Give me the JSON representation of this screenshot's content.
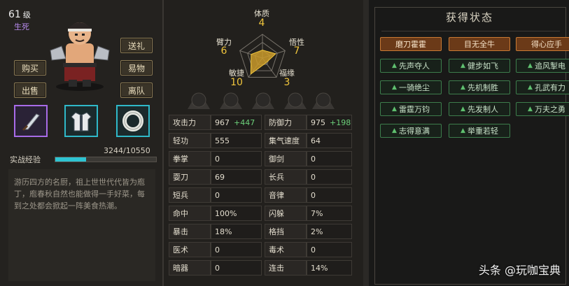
{
  "character": {
    "level": "61",
    "level_unit": "级",
    "title": "生死"
  },
  "buttons": {
    "gift": "送礼",
    "buy": "购买",
    "trade": "易物",
    "sell": "出售",
    "leave": "离队"
  },
  "equipment": [
    {
      "name": "knife-icon"
    },
    {
      "name": "robe-icon"
    },
    {
      "name": "ring-icon"
    }
  ],
  "experience": {
    "label": "实战经验",
    "value": "3244/10550",
    "fraction": 0.3075
  },
  "description": "游历四方的名厨，祖上世世代代皆为庖丁，庖春秋自然也能做得一手好菜，每到之处都会掀起一阵美食热潮。",
  "radar": {
    "top": {
      "label": "体质",
      "value": "4"
    },
    "left": {
      "label": "臂力",
      "value": "6"
    },
    "right": {
      "label": "悟性",
      "value": "7"
    },
    "bottom_left": {
      "label": "敏捷",
      "value": "10"
    },
    "bottom_right": {
      "label": "福缘",
      "value": "3"
    },
    "max": 12
  },
  "stats": [
    {
      "lname": "攻击力",
      "lval": "967",
      "lbonus": "+447",
      "rname": "防御力",
      "rval": "975",
      "rbonus": "+198"
    },
    {
      "lname": "轻功",
      "lval": "555",
      "lbonus": "",
      "rname": "集气速度",
      "rval": "64",
      "rbonus": ""
    },
    {
      "lname": "拳掌",
      "lval": "0",
      "lbonus": "",
      "rname": "御剑",
      "rval": "0",
      "rbonus": ""
    },
    {
      "lname": "耍刀",
      "lval": "69",
      "lbonus": "",
      "rname": "长兵",
      "rval": "0",
      "rbonus": ""
    },
    {
      "lname": "短兵",
      "lval": "0",
      "lbonus": "",
      "rname": "音律",
      "rval": "0",
      "rbonus": ""
    },
    {
      "lname": "命中",
      "lval": "100%",
      "lbonus": "",
      "rname": "闪躲",
      "rval": "7%",
      "rbonus": ""
    },
    {
      "lname": "暴击",
      "lval": "18%",
      "lbonus": "",
      "rname": "格挡",
      "rval": "2%",
      "rbonus": ""
    },
    {
      "lname": "医术",
      "lval": "0",
      "lbonus": "",
      "rname": "毒术",
      "rval": "0",
      "rbonus": ""
    },
    {
      "lname": "暗器",
      "lval": "0",
      "lbonus": "",
      "rname": "连击",
      "rval": "14%",
      "rbonus": ""
    }
  ],
  "status_panel": {
    "title": "获得状态",
    "tags": [
      {
        "label": "磨刀霍霍",
        "highlight": true,
        "arrow": false
      },
      {
        "label": "目无全牛",
        "highlight": true,
        "arrow": false
      },
      {
        "label": "得心应手",
        "highlight": true,
        "arrow": false
      },
      {
        "label": "先声夺人",
        "highlight": false,
        "arrow": true
      },
      {
        "label": "健步如飞",
        "highlight": false,
        "arrow": true
      },
      {
        "label": "追风掣电",
        "highlight": false,
        "arrow": true
      },
      {
        "label": "一骑绝尘",
        "highlight": false,
        "arrow": true
      },
      {
        "label": "先机制胜",
        "highlight": false,
        "arrow": true
      },
      {
        "label": "孔武有力",
        "highlight": false,
        "arrow": true
      },
      {
        "label": "雷霆万钧",
        "highlight": false,
        "arrow": true
      },
      {
        "label": "先发制人",
        "highlight": false,
        "arrow": true
      },
      {
        "label": "万夫之勇",
        "highlight": false,
        "arrow": true
      },
      {
        "label": "志得意满",
        "highlight": false,
        "arrow": true
      },
      {
        "label": "举重若轻",
        "highlight": false,
        "arrow": true
      }
    ]
  },
  "watermark": "头条 @玩咖宝典",
  "colors": {
    "accent_cyan": "#2ec4d2",
    "accent_gold": "#f0c53c",
    "bonus_green": "#6cd07a",
    "purple": "#b98cf0"
  }
}
